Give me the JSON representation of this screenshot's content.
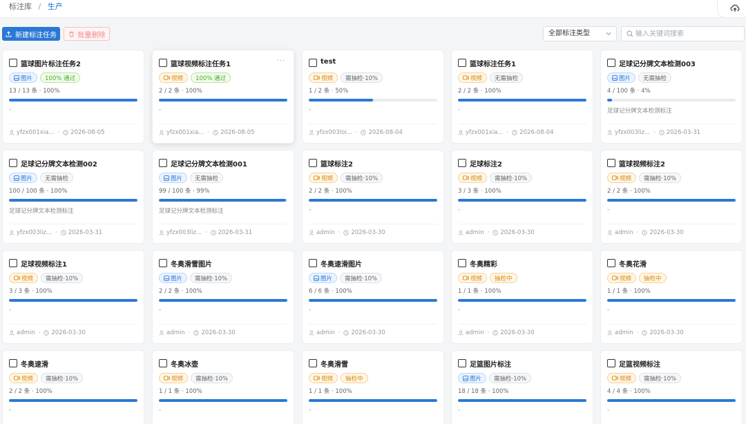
{
  "breadcrumb": {
    "root": "标注库",
    "separator": "/",
    "current": "生产"
  },
  "toolbar": {
    "new_task_label": "新建标注任务",
    "batch_delete_label": "批量删除",
    "type_select_value": "全部标注类型",
    "search_placeholder": "输入关键词搜索"
  },
  "colors": {
    "primary": "#2a78d6",
    "danger": "#f08a8a",
    "success": "#4caa2c",
    "warning": "#d98a12"
  },
  "cards": [
    {
      "title": "篮球图片标注任务2",
      "type": "图片",
      "type_kind": "image",
      "status": "100% 通过",
      "status_kind": "green",
      "count": "13 / 13 条 · 100%",
      "progress": 1.0,
      "desc": "-",
      "user": "yfzx001xia...",
      "date": "2026-08-05"
    },
    {
      "title": "篮球视频标注任务1",
      "type": "视频",
      "type_kind": "video",
      "status": "100% 通过",
      "status_kind": "green",
      "count": "2 / 2 条 · 100%",
      "progress": 1.0,
      "desc": "-",
      "user": "yfzx001xia...",
      "date": "2026-08-05",
      "more": "···"
    },
    {
      "title": "test",
      "type": "视频",
      "type_kind": "video",
      "status": "需抽检·10%",
      "status_kind": "gray",
      "count": "1 / 2 条 · 50%",
      "progress": 0.5,
      "desc": "-",
      "user": "yfzx003loi...",
      "date": "2026-08-04"
    },
    {
      "title": "篮球标注任务1",
      "type": "视频",
      "type_kind": "video",
      "status": "无需抽检",
      "status_kind": "gray",
      "count": "2 / 2 条 · 100%",
      "progress": 1.0,
      "desc": "-",
      "user": "yfzx001xia...",
      "date": "2026-08-04"
    },
    {
      "title": "足球记分牌文本检测003",
      "type": "图片",
      "type_kind": "image",
      "status": "无需抽检",
      "status_kind": "gray",
      "count": "4 / 100 条 · 4%",
      "progress": 0.04,
      "desc": "足球记分牌文本检测标注",
      "user": "yfzx003liz...",
      "date": "2026-03-31"
    },
    {
      "title": "足球记分牌文本检测002",
      "type": "图片",
      "type_kind": "image",
      "status": "无需抽检",
      "status_kind": "gray",
      "count": "100 / 100 条 · 100%",
      "progress": 1.0,
      "desc": "足球记分牌文本检测标注",
      "user": "yfzx003liz...",
      "date": "2026-03-31"
    },
    {
      "title": "足球记分牌文本检测001",
      "type": "图片",
      "type_kind": "image",
      "status": "无需抽检",
      "status_kind": "gray",
      "count": "99 / 100 条 · 99%",
      "progress": 0.99,
      "desc": "足球记分牌文本检测标注",
      "user": "yfzx003liz...",
      "date": "2026-03-31"
    },
    {
      "title": "篮球标注2",
      "type": "视频",
      "type_kind": "video",
      "status": "需抽检·10%",
      "status_kind": "gray",
      "count": "2 / 2 条 · 100%",
      "progress": 1.0,
      "desc": "-",
      "user": "admin",
      "date": "2026-03-30"
    },
    {
      "title": "足球标注2",
      "type": "视频",
      "type_kind": "video",
      "status": "需抽检·10%",
      "status_kind": "gray",
      "count": "3 / 3 条 · 100%",
      "progress": 1.0,
      "desc": "-",
      "user": "admin",
      "date": "2026-03-30"
    },
    {
      "title": "篮球视频标注2",
      "type": "视频",
      "type_kind": "video",
      "status": "需抽检·10%",
      "status_kind": "gray",
      "count": "2 / 2 条 · 100%",
      "progress": 1.0,
      "desc": "-",
      "user": "admin",
      "date": "2026-03-30"
    },
    {
      "title": "足球视频标注1",
      "type": "视频",
      "type_kind": "video",
      "status": "需抽检·10%",
      "status_kind": "gray",
      "count": "3 / 3 条 · 100%",
      "progress": 1.0,
      "desc": "-",
      "user": "admin",
      "date": "2026-03-30"
    },
    {
      "title": "冬奥滑雪图片",
      "type": "图片",
      "type_kind": "image",
      "status": "需抽检·10%",
      "status_kind": "gray",
      "count": "2 / 2 条 · 100%",
      "progress": 1.0,
      "desc": "-",
      "user": "admin",
      "date": "2026-03-30"
    },
    {
      "title": "冬奥速滑图片",
      "type": "图片",
      "type_kind": "image",
      "status": "需抽检·10%",
      "status_kind": "gray",
      "count": "6 / 6 条 · 100%",
      "progress": 1.0,
      "desc": "-",
      "user": "admin",
      "date": "2026-03-30"
    },
    {
      "title": "冬奥精彩",
      "type": "视频",
      "type_kind": "video",
      "status": "抽检中",
      "status_kind": "orange",
      "count": "1 / 1 条 · 100%",
      "progress": 1.0,
      "desc": "-",
      "user": "admin",
      "date": "2026-03-30"
    },
    {
      "title": "冬奥花滑",
      "type": "视频",
      "type_kind": "video",
      "status": "抽检中",
      "status_kind": "orange",
      "count": "1 / 1 条 · 100%",
      "progress": 1.0,
      "desc": "-",
      "user": "admin",
      "date": "2026-03-30"
    },
    {
      "title": "冬奥速滑",
      "type": "视频",
      "type_kind": "video",
      "status": "需抽检·10%",
      "status_kind": "gray",
      "count": "2 / 2 条 · 100%",
      "progress": 1.0,
      "desc": "-",
      "user": "",
      "date": ""
    },
    {
      "title": "冬奥冰壶",
      "type": "视频",
      "type_kind": "video",
      "status": "需抽检·10%",
      "status_kind": "gray",
      "count": "1 / 1 条 · 100%",
      "progress": 1.0,
      "desc": "-",
      "user": "",
      "date": ""
    },
    {
      "title": "冬奥滑雪",
      "type": "视频",
      "type_kind": "video",
      "status": "抽检中",
      "status_kind": "orange",
      "count": "1 / 1 条 · 100%",
      "progress": 1.0,
      "desc": "-",
      "user": "",
      "date": ""
    },
    {
      "title": "足篮图片标注",
      "type": "图片",
      "type_kind": "image",
      "status": "需抽检·10%",
      "status_kind": "gray",
      "count": "18 / 18 条 · 100%",
      "progress": 1.0,
      "desc": "-",
      "user": "",
      "date": ""
    },
    {
      "title": "足篮视频标注",
      "type": "视频",
      "type_kind": "video",
      "status": "需抽检·10%",
      "status_kind": "gray",
      "count": "4 / 4 条 · 100%",
      "progress": 1.0,
      "desc": "-",
      "user": "",
      "date": ""
    }
  ]
}
